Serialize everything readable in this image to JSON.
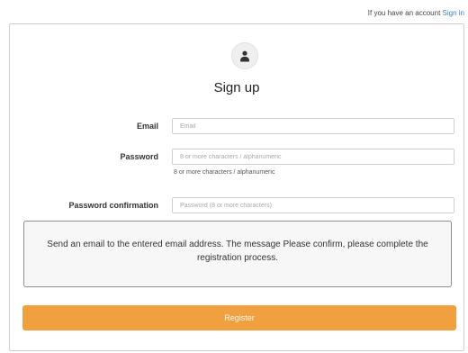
{
  "top": {
    "prompt": "If you have an account",
    "signin_link": "Sign in"
  },
  "form": {
    "title": "Sign up",
    "email": {
      "label": "Email",
      "placeholder": "Email",
      "value": ""
    },
    "password": {
      "label": "Password",
      "placeholder": "8 or more characters / alphanumeric",
      "value": "",
      "help": "8 or more characters / alphanumeric"
    },
    "password_confirmation": {
      "label": "Password confirmation",
      "placeholder": "Password (8 or more characters)",
      "value": ""
    },
    "notice": "Send an email to the entered email address. The message Please confirm, please complete the registration process.",
    "register_label": "Register"
  },
  "icons": {
    "avatar": "user-avatar-icon"
  },
  "colors": {
    "accent": "#f1a040",
    "link": "#3b7ec7",
    "notice_border": "#8f8f8f"
  }
}
